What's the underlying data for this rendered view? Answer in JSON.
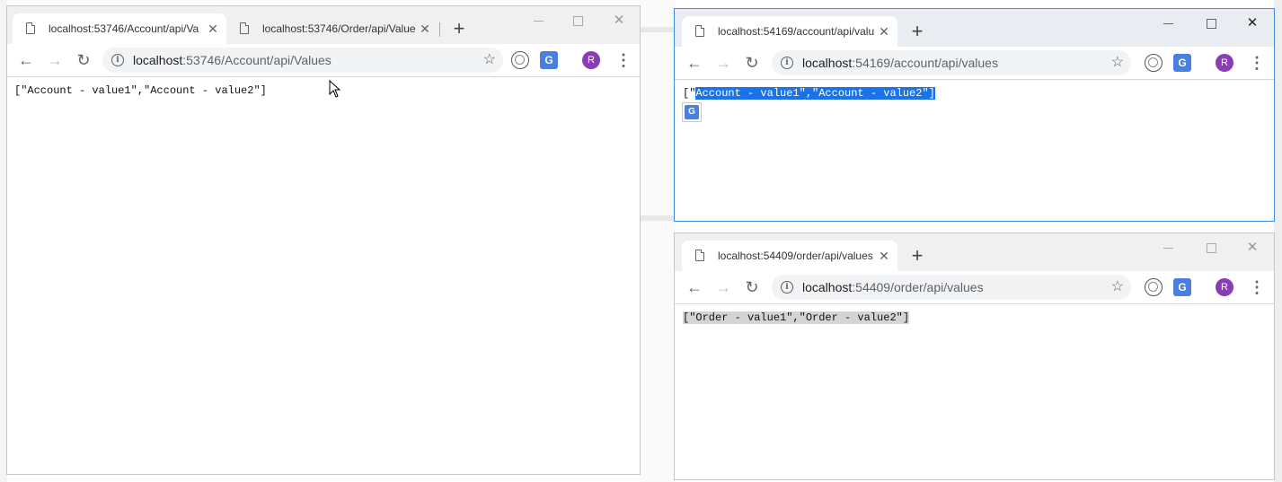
{
  "windows": [
    {
      "tabs": [
        {
          "title": "localhost:53746/Account/api/Va",
          "active": true
        },
        {
          "title": "localhost:53746/Order/api/Value",
          "active": false
        }
      ],
      "url_host": "localhost",
      "url_rest": ":53746/Account/api/Values",
      "body": "[\"Account - value1\",\"Account - value2\"]",
      "avatar": "R"
    },
    {
      "tabs": [
        {
          "title": "localhost:54169/account/api/valu",
          "active": true
        }
      ],
      "url_host": "localhost",
      "url_rest": ":54169/account/api/values",
      "body_prefix": "[\"",
      "body_selected": "Account - value1\",\"Account - value2\"]",
      "avatar": "R"
    },
    {
      "tabs": [
        {
          "title": "localhost:54409/order/api/values",
          "active": true
        }
      ],
      "url_host": "localhost",
      "url_rest": ":54409/order/api/values",
      "body": "[\"Order - value1\",\"Order - value2\"]",
      "avatar": "R"
    }
  ],
  "icons": {
    "close": "✕",
    "new_tab": "+",
    "back": "←",
    "forward": "→",
    "reload": "↻",
    "info": "i",
    "star": "☆",
    "menu": "⋮",
    "translate": "G"
  },
  "colors": {
    "selection": "#1a73e8",
    "avatar": "#8a3cb4",
    "active_border": "#3c8fd8"
  }
}
